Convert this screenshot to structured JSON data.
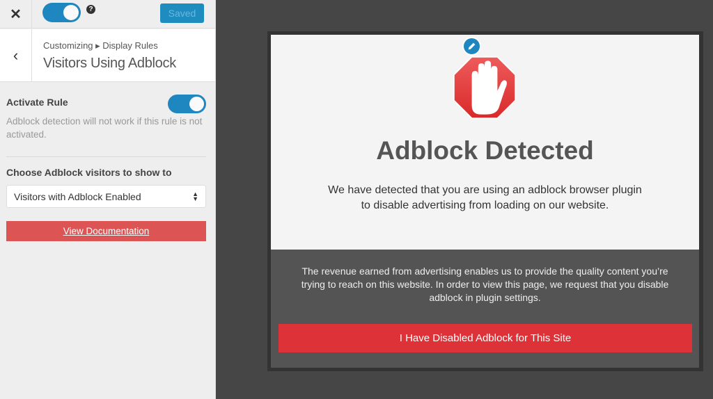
{
  "topbar": {
    "close_icon": "close-icon",
    "publish_toggle_on": true,
    "help_icon_glyph": "?",
    "saved_label": "Saved"
  },
  "header": {
    "back_icon": "chevron-left-icon",
    "breadcrumb": "Customizing ▸ Display Rules",
    "title": "Visitors Using Adblock"
  },
  "settings": {
    "activate_label": "Activate Rule",
    "activate_on": true,
    "activate_description": "Adblock detection will not work if this rule is not activated.",
    "choose_label": "Choose Adblock visitors to show to",
    "select_value": "Visitors with Adblock Enabled",
    "doc_button": "View Documentation"
  },
  "preview": {
    "edit_icon": "pencil-icon",
    "stop_icon": "stop-hand-icon",
    "title": "Adblock Detected",
    "message": "We have detected that you are using an adblock browser plugin to disable advertising from loading on our website.",
    "info": "The revenue earned from advertising enables us to provide the quality content you’re trying to reach on this website. In order to view this page, we request that you disable adblock in plugin settings.",
    "button": "I Have Disabled Adblock for This Site"
  },
  "colors": {
    "accent_blue": "#1e87c0",
    "doc_red": "#dd5454",
    "button_red": "#dd3238",
    "stop_red": "#e03a3a"
  }
}
